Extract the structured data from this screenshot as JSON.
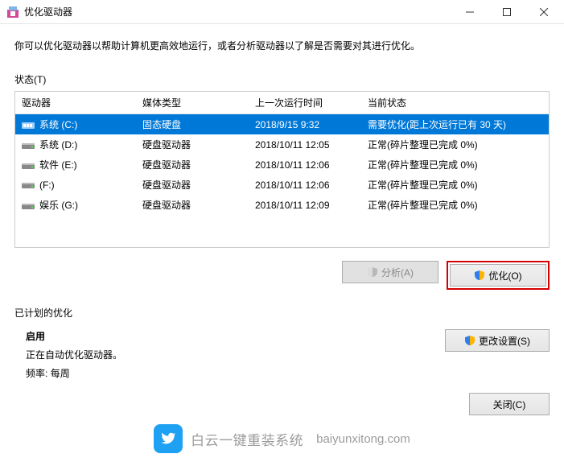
{
  "window": {
    "title": "优化驱动器"
  },
  "desc": "你可以优化驱动器以帮助计算机更高效地运行，或者分析驱动器以了解是否需要对其进行优化。",
  "statusLabel": "状态(T)",
  "columns": {
    "drive": "驱动器",
    "mediaType": "媒体类型",
    "lastRun": "上一次运行时间",
    "currentStatus": "当前状态"
  },
  "rows": [
    {
      "drive": "系统 (C:)",
      "type": "ssd",
      "mediaType": "固态硬盘",
      "lastRun": "2018/9/15 9:32",
      "status": "需要优化(距上次运行已有 30 天)",
      "selected": true
    },
    {
      "drive": "系统 (D:)",
      "type": "hdd",
      "mediaType": "硬盘驱动器",
      "lastRun": "2018/10/11 12:05",
      "status": "正常(碎片整理已完成 0%)",
      "selected": false
    },
    {
      "drive": "软件 (E:)",
      "type": "hdd",
      "mediaType": "硬盘驱动器",
      "lastRun": "2018/10/11 12:06",
      "status": "正常(碎片整理已完成 0%)",
      "selected": false
    },
    {
      "drive": "(F:)",
      "type": "hdd",
      "mediaType": "硬盘驱动器",
      "lastRun": "2018/10/11 12:06",
      "status": "正常(碎片整理已完成 0%)",
      "selected": false
    },
    {
      "drive": "娱乐 (G:)",
      "type": "hdd",
      "mediaType": "硬盘驱动器",
      "lastRun": "2018/10/11 12:09",
      "status": "正常(碎片整理已完成 0%)",
      "selected": false
    }
  ],
  "buttons": {
    "analyze": "分析(A)",
    "optimize": "优化(O)",
    "changeSettings": "更改设置(S)",
    "close": "关闭(C)"
  },
  "schedule": {
    "sectionLabel": "已计划的优化",
    "enabled": "启用",
    "line1": "正在自动优化驱动器。",
    "freqLabel": "频率:",
    "freqValue": "每周"
  },
  "watermark": {
    "main": "白云一键重装系统",
    "sub": "baiyunxitong.com"
  }
}
